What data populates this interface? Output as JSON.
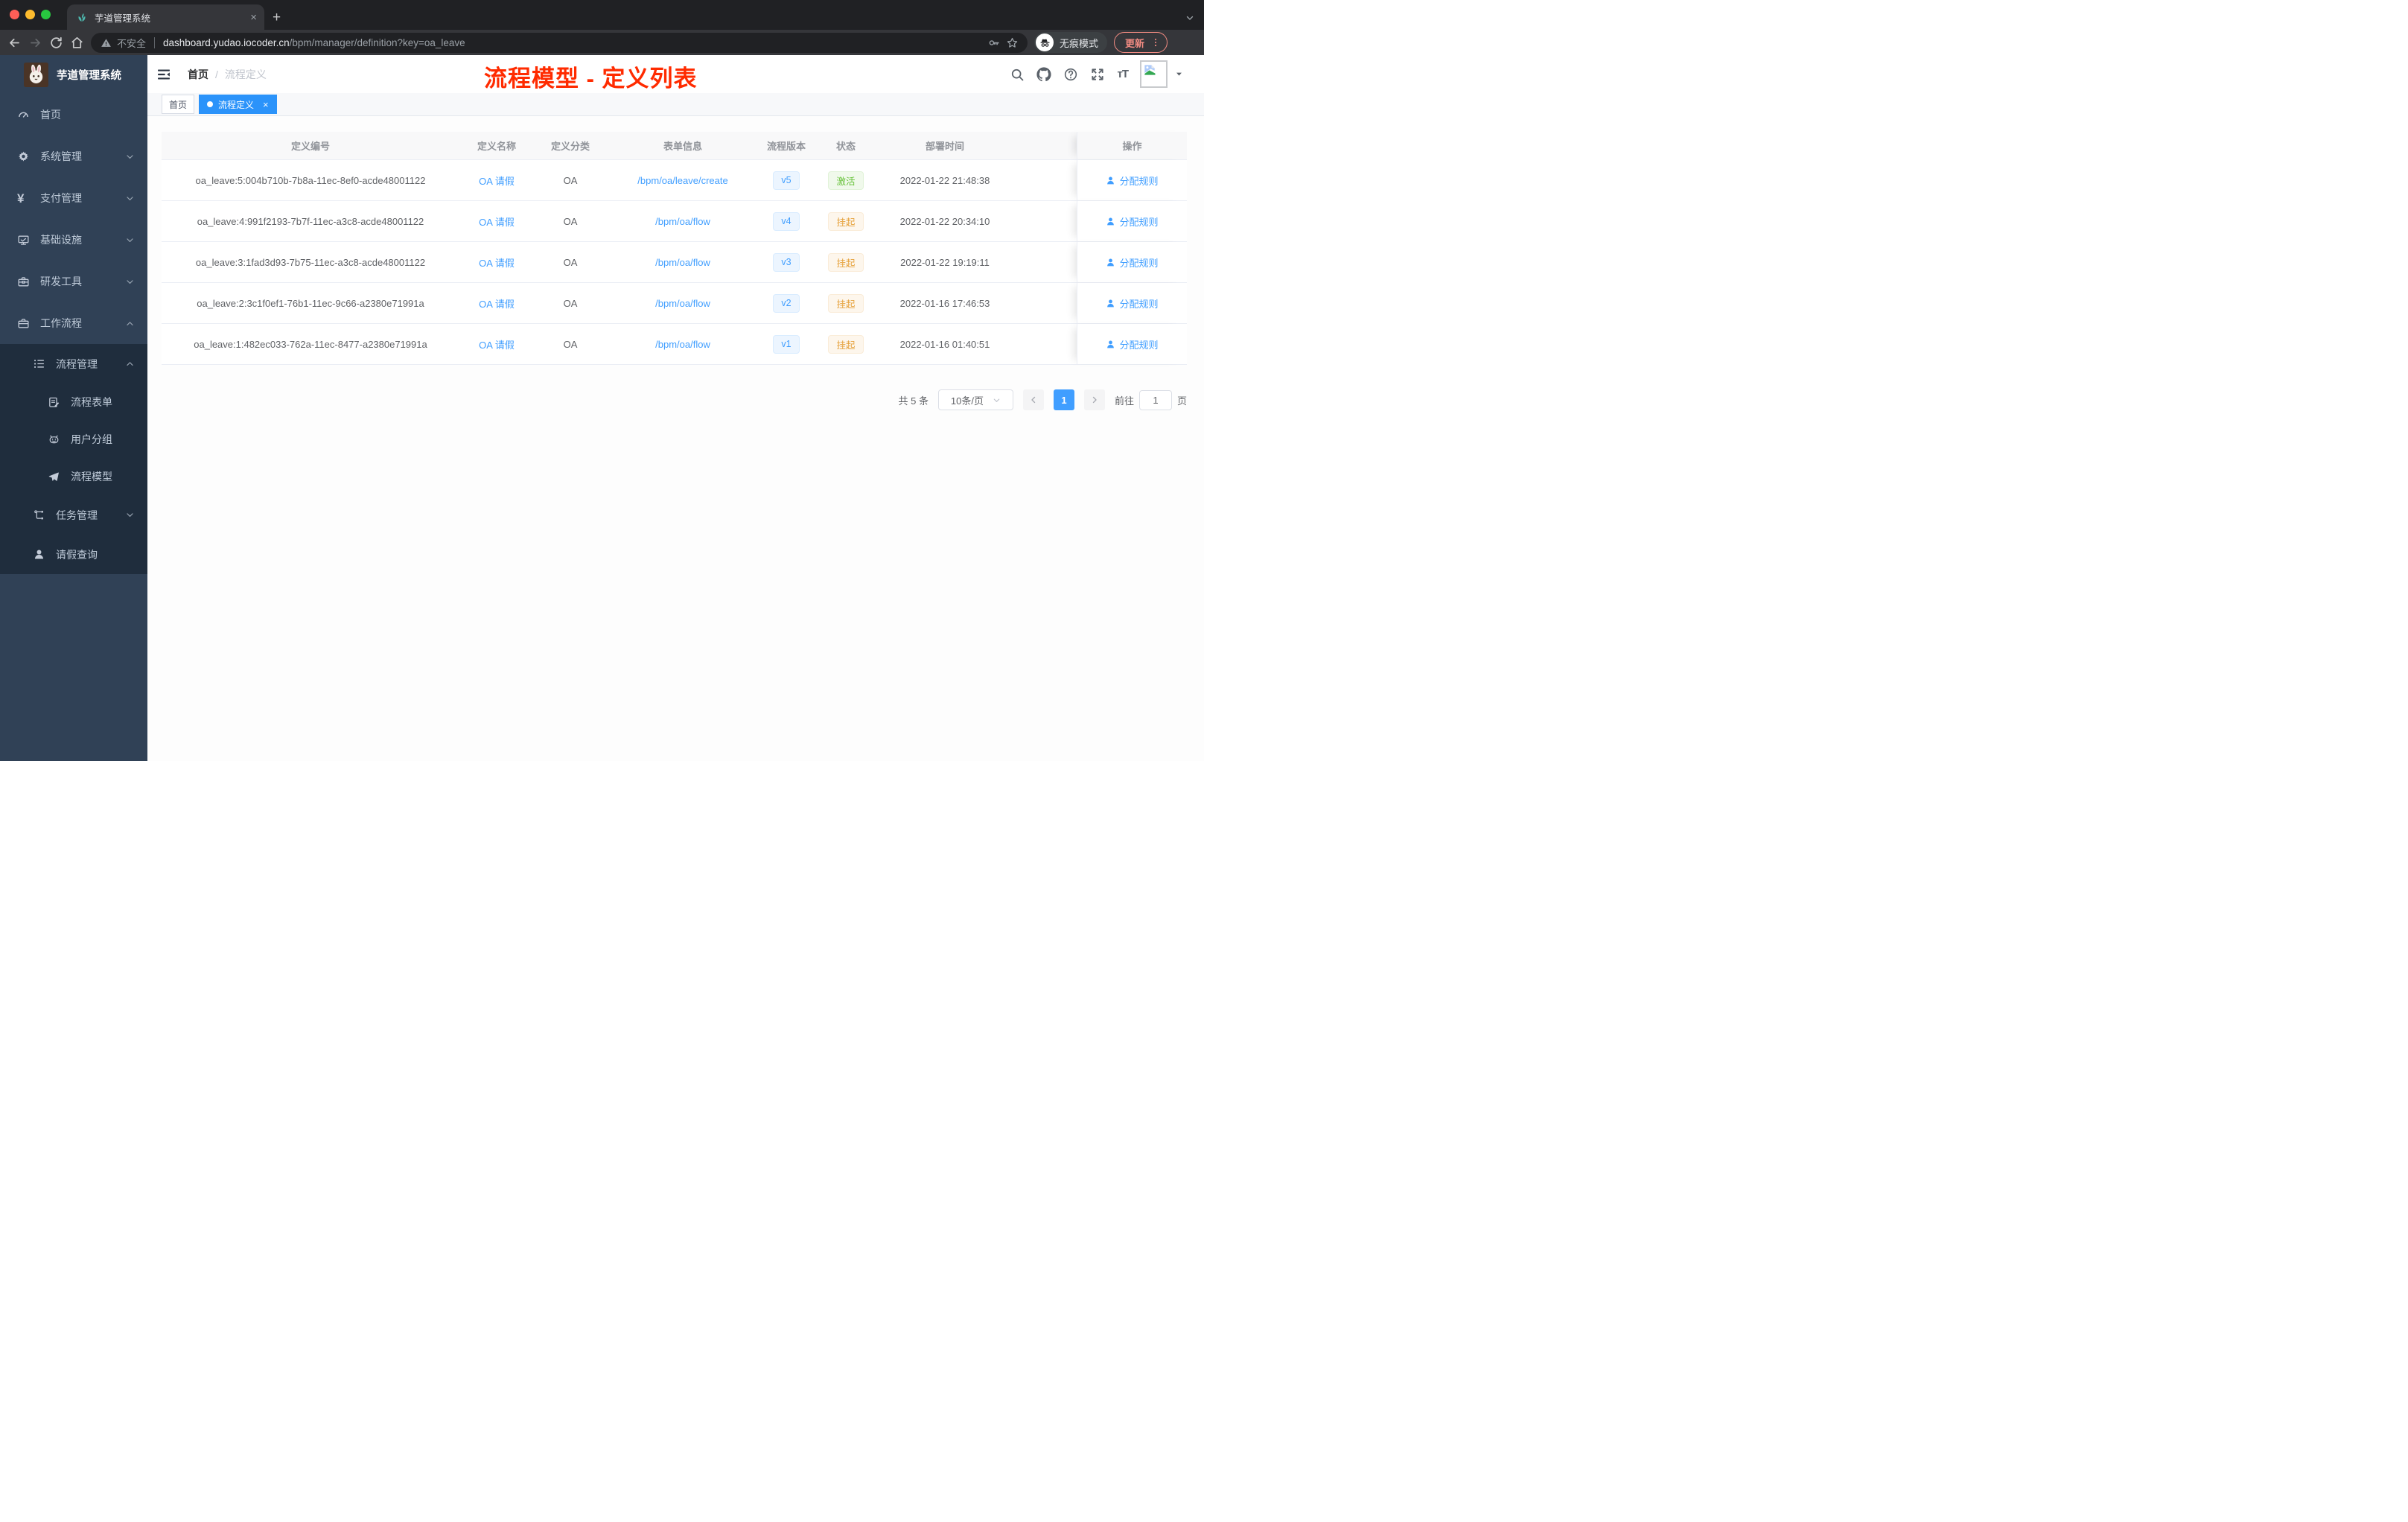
{
  "browser": {
    "tab_title": "芋道管理系统",
    "new_tab_label": "+",
    "security_label": "不安全",
    "url_host": "dashboard.yudao.iocoder.cn",
    "url_path": "/bpm/manager/definition?key=oa_leave",
    "incognito_label": "无痕模式",
    "update_button_label": "更新"
  },
  "sidebar": {
    "logo_title": "芋道管理系统",
    "menu": [
      {
        "label": "首页",
        "icon": "dashboard",
        "level": 1,
        "chevron": null,
        "dark": false
      },
      {
        "label": "系统管理",
        "icon": "gear",
        "level": 1,
        "chevron": "down",
        "dark": false
      },
      {
        "label": "支付管理",
        "icon": "yen",
        "level": 1,
        "chevron": "down",
        "dark": false
      },
      {
        "label": "基础设施",
        "icon": "monitor",
        "level": 1,
        "chevron": "down",
        "dark": false
      },
      {
        "label": "研发工具",
        "icon": "toolbox",
        "level": 1,
        "chevron": "down",
        "dark": false
      },
      {
        "label": "工作流程",
        "icon": "briefcase",
        "level": 1,
        "chevron": "up",
        "dark": false
      },
      {
        "label": "流程管理",
        "icon": "flow",
        "level": 2,
        "chevron": "up",
        "dark": true
      },
      {
        "label": "流程表单",
        "icon": "form",
        "level": 3,
        "chevron": null,
        "dark": true
      },
      {
        "label": "用户分组",
        "icon": "robot",
        "level": 3,
        "chevron": null,
        "dark": true
      },
      {
        "label": "流程模型",
        "icon": "send",
        "level": 3,
        "chevron": null,
        "dark": true
      },
      {
        "label": "任务管理",
        "icon": "tree",
        "level": 2,
        "chevron": "down",
        "dark": true
      },
      {
        "label": "请假查询",
        "icon": "user",
        "level": 2,
        "chevron": null,
        "dark": true
      }
    ]
  },
  "header": {
    "breadcrumb": {
      "home": "首页",
      "separator": "/",
      "current": "流程定义"
    },
    "annotation_title": "流程模型 - 定义列表",
    "action_icons": [
      "search-icon",
      "github-icon",
      "help-icon",
      "fullscreen-icon",
      "font-size-icon",
      "avatar",
      "caret-down-icon"
    ]
  },
  "tags": {
    "home": {
      "label": "首页",
      "active": false
    },
    "current": {
      "label": "流程定义",
      "active": true,
      "close": "×"
    }
  },
  "table": {
    "columns": [
      "定义编号",
      "定义名称",
      "定义分类",
      "表单信息",
      "流程版本",
      "状态",
      "部署时间",
      "操作"
    ],
    "rows": [
      {
        "id": "oa_leave:5:004b710b-7b8a-11ec-8ef0-acde48001122",
        "name": "OA 请假",
        "category": "OA",
        "form": "/bpm/oa/leave/create",
        "version": "v5",
        "status": "激活",
        "status_type": "success",
        "deploy_time": "2022-01-22 21:48:38",
        "action": "分配规则"
      },
      {
        "id": "oa_leave:4:991f2193-7b7f-11ec-a3c8-acde48001122",
        "name": "OA 请假",
        "category": "OA",
        "form": "/bpm/oa/flow",
        "version": "v4",
        "status": "挂起",
        "status_type": "warning",
        "deploy_time": "2022-01-22 20:34:10",
        "action": "分配规则"
      },
      {
        "id": "oa_leave:3:1fad3d93-7b75-11ec-a3c8-acde48001122",
        "name": "OA 请假",
        "category": "OA",
        "form": "/bpm/oa/flow",
        "version": "v3",
        "status": "挂起",
        "status_type": "warning",
        "deploy_time": "2022-01-22 19:19:11",
        "action": "分配规则"
      },
      {
        "id": "oa_leave:2:3c1f0ef1-76b1-11ec-9c66-a2380e71991a",
        "name": "OA 请假",
        "category": "OA",
        "form": "/bpm/oa/flow",
        "version": "v2",
        "status": "挂起",
        "status_type": "warning",
        "deploy_time": "2022-01-16 17:46:53",
        "action": "分配规则"
      },
      {
        "id": "oa_leave:1:482ec033-762a-11ec-8477-a2380e71991a",
        "name": "OA 请假",
        "category": "OA",
        "form": "/bpm/oa/flow",
        "version": "v1",
        "status": "挂起",
        "status_type": "warning",
        "deploy_time": "2022-01-16 01:40:51",
        "action": "分配规则"
      }
    ]
  },
  "pagination": {
    "total_label": "共 5 条",
    "page_size_label": "10条/页",
    "current_page": "1",
    "goto_label": "前往",
    "goto_value": "1",
    "page_unit": "页"
  },
  "colors": {
    "accent_blue": "#409eff",
    "active_tag_blue": "#2b93fa",
    "annotation_red": "#ff2b00",
    "status_active_green": "#67c23a",
    "status_suspended_orange": "#e6a23c",
    "sidebar_bg": "#304156",
    "submenu_bg": "#1f2d3d",
    "update_button_red": "#f28b82"
  }
}
